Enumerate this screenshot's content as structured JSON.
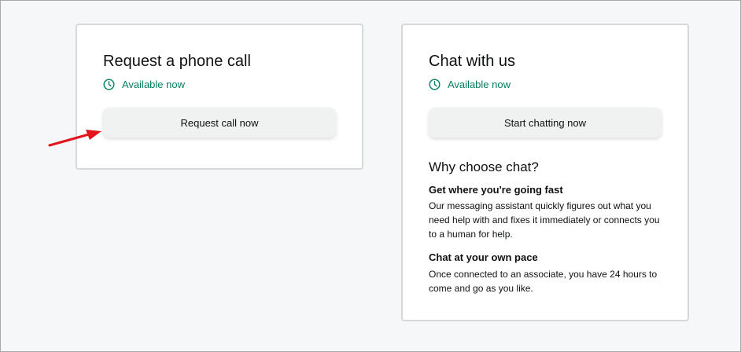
{
  "phone_card": {
    "title": "Request a phone call",
    "availability": "Available now",
    "button_label": "Request call now"
  },
  "chat_card": {
    "title": "Chat with us",
    "availability": "Available now",
    "button_label": "Start chatting now",
    "why_title": "Why choose chat?",
    "sections": [
      {
        "heading": "Get where you're going fast",
        "body": "Our messaging assistant quickly figures out what you need help with and fixes it immediately or connects you to a human for help."
      },
      {
        "heading": "Chat at your own pace",
        "body": "Once connected to an associate, you have 24 hours to come and go as you like."
      }
    ]
  },
  "annotation": {
    "arrow_icon": "red-arrow-icon",
    "color": "#e3141b"
  },
  "colors": {
    "available": "#067d62",
    "button_bg": "#f0f2f2",
    "card_border": "#d5d9d9"
  }
}
